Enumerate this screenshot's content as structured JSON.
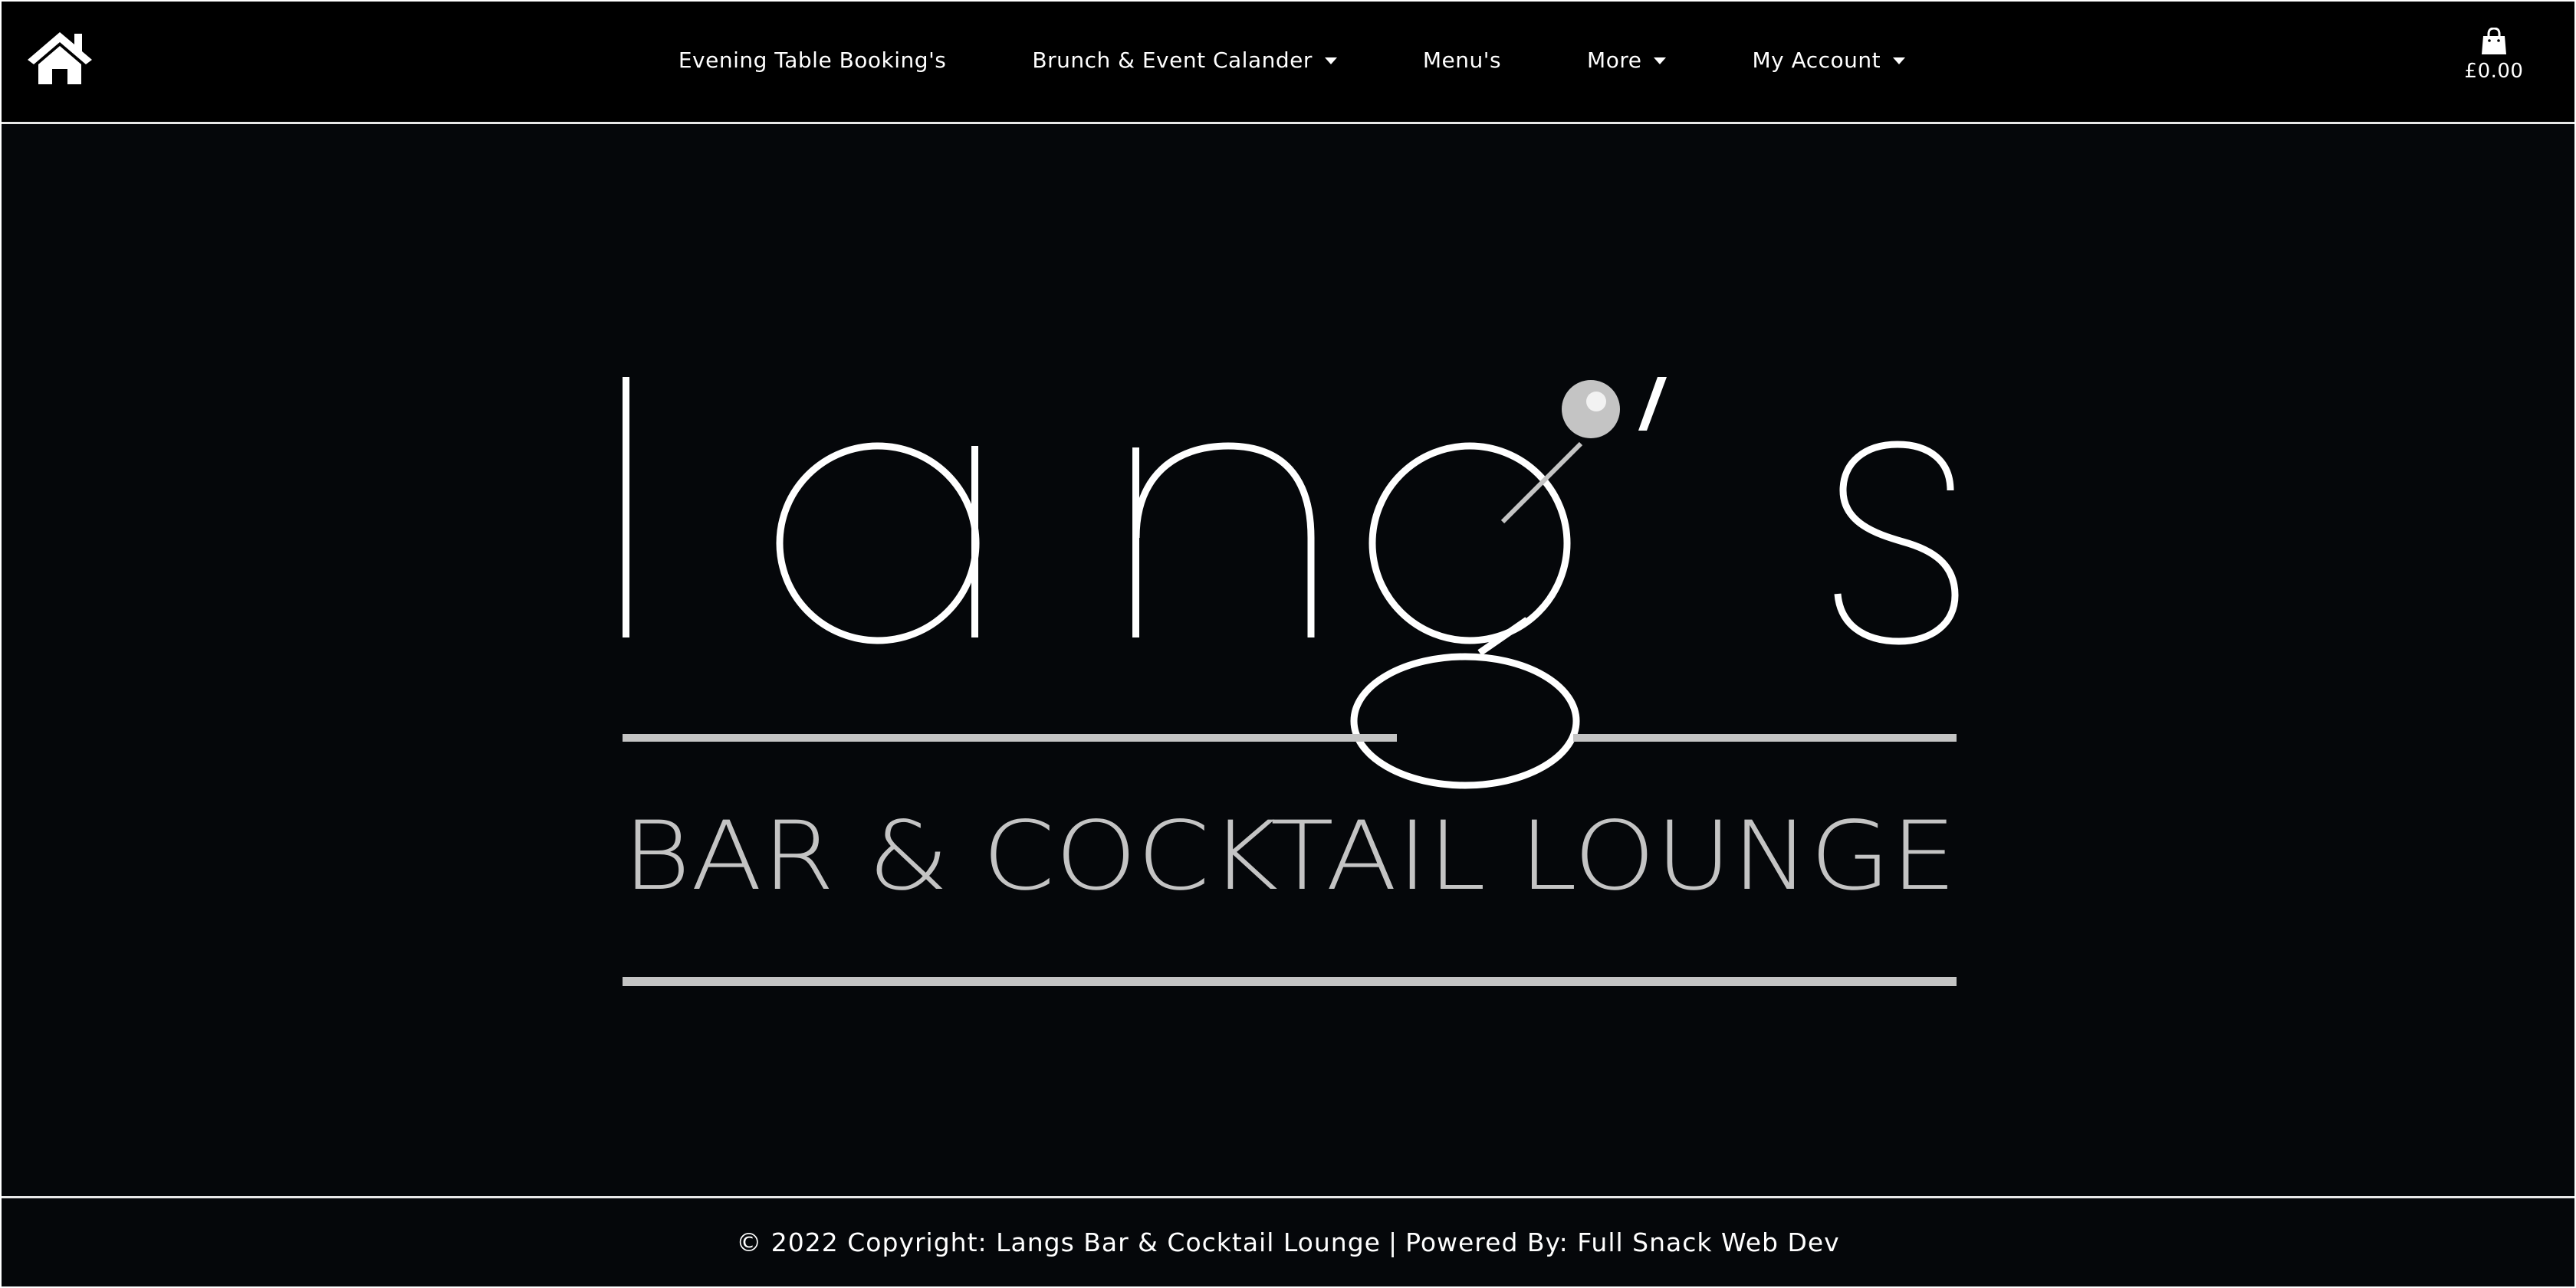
{
  "nav": {
    "home_icon": "home-icon",
    "items": [
      {
        "label": "Evening Table Booking's",
        "dropdown": false
      },
      {
        "label": "Brunch & Event Calander",
        "dropdown": true
      },
      {
        "label": "Menu's",
        "dropdown": false
      },
      {
        "label": "More",
        "dropdown": true
      },
      {
        "label": "My Account",
        "dropdown": true
      }
    ],
    "cart": {
      "icon": "shopping-bag-icon",
      "total": "£0.00"
    }
  },
  "hero": {
    "logo": {
      "wordmark": "lang's",
      "tagline": "BAR & COCKTAIL LOUNGE"
    }
  },
  "footer": {
    "copyright": "© 2022 Copyright: Langs Bar & Cocktail Lounge",
    "separator": "|",
    "powered_by": "Powered By: Full Snack Web Dev"
  },
  "colors": {
    "background": "#05070a",
    "text": "#ffffff",
    "logo_accent": "#c4c4c4",
    "border": "#e8e8e8"
  }
}
